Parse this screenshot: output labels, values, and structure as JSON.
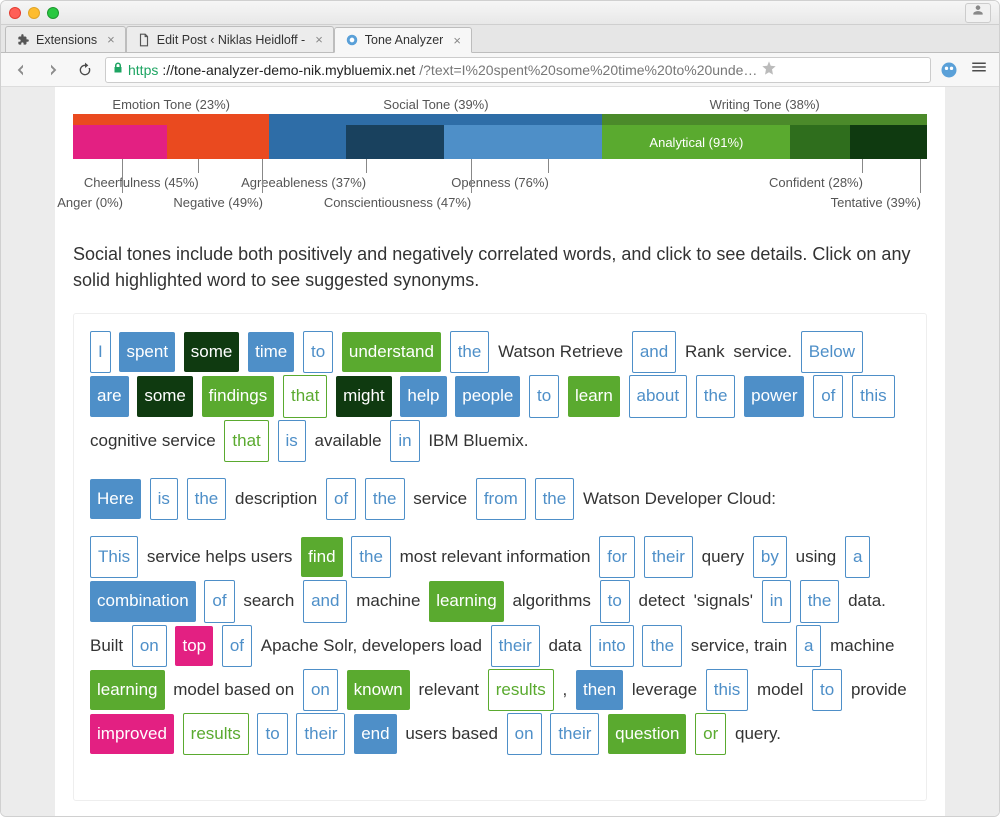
{
  "browser": {
    "tabs": [
      {
        "label": "Extensions",
        "active": false,
        "icon": "puzzle"
      },
      {
        "label": "Edit Post ‹ Niklas Heidloff - ",
        "active": false,
        "icon": "doc"
      },
      {
        "label": "Tone Analyzer",
        "active": true,
        "icon": "globe"
      }
    ],
    "url_https": "https",
    "url_host": "://tone-analyzer-demo-nik.mybluemix.net",
    "url_path": "/?text=I%20spent%20some%20time%20to%20unde…"
  },
  "categories": {
    "emotion": "Emotion Tone (23%)",
    "social": "Social Tone (39%)",
    "writing": "Writing Tone (38%)"
  },
  "chart_data": {
    "type": "bar",
    "groups": [
      {
        "name": "Emotion Tone",
        "pct": 23,
        "color": "#ea4a1f",
        "segments": [
          {
            "label": "Cheerfulness (45%)",
            "pct": 45,
            "color": "#e32082"
          },
          {
            "label": "Anger (0%)",
            "pct": 0,
            "color": "#e32082"
          },
          {
            "label": "Negative (49%)",
            "pct": 49,
            "color": "#ea4a1f"
          }
        ]
      },
      {
        "name": "Social Tone",
        "pct": 39,
        "color": "#2e6da7",
        "segments": [
          {
            "label": "Agreeableness (37%)",
            "pct": 37,
            "color": "#2e6da7"
          },
          {
            "label": "Conscientiousness (47%)",
            "pct": 47,
            "color": "#19415e"
          },
          {
            "label": "Openness (76%)",
            "pct": 76,
            "color": "#4e8fc8"
          }
        ]
      },
      {
        "name": "Writing Tone",
        "pct": 38,
        "color": "#4b8a2a",
        "segments": [
          {
            "label": "Analytical (91%)",
            "pct": 91,
            "color": "#5aaa2f"
          },
          {
            "label": "Confident (28%)",
            "pct": 28,
            "color": "#2f6e1d"
          },
          {
            "label": "Tentative (39%)",
            "pct": 39,
            "color": "#0f3a10"
          }
        ]
      }
    ],
    "highlight": "Analytical (91%)"
  },
  "ticks": {
    "cheer": "Cheerfulness (45%)",
    "anger": "Anger (0%)",
    "neg": "Negative (49%)",
    "agree": "Agreeableness (37%)",
    "consc": "Conscientiousness (47%)",
    "open": "Openness (76%)",
    "analytical": "Analytical (91%)",
    "conf": "Confident (28%)",
    "tent": "Tentative (39%)"
  },
  "instructions": "Social tones include both positively and negatively correlated words, and click to see details. Click on any solid highlighted word to see suggested synonyms.",
  "words": {
    "I": "I",
    "spent": "spent",
    "some": "some",
    "time": "time",
    "to": "to",
    "understand": "understand",
    "the": "the",
    "WatsonRetrieve": "Watson Retrieve",
    "and": "and",
    "Rank": "Rank",
    "service": "service.",
    "Below": "Below",
    "are": "are",
    "findings": "findings",
    "that": "that",
    "might": "might",
    "help": "help",
    "people": "people",
    "learn": "learn",
    "about": "about",
    "power": "power",
    "of": "of",
    "this": "this",
    "cognitiveservice": "cognitive service",
    "is": "is",
    "available": "available",
    "in": "in",
    "IBMBluemix": "IBM Bluemix.",
    "Here": "Here",
    "description": "description",
    "serviceword": "service",
    "from": "from",
    "WDC": "Watson Developer Cloud:",
    "This": "This",
    "servicehelps": "service helps users",
    "find": "find",
    "mostrelevant": "most relevant information",
    "for": "for",
    "their": "their",
    "query": "query",
    "by": "by",
    "using": "using",
    "a": "a",
    "combination": "combination",
    "search": "search",
    "machine": "machine",
    "learning": "learning",
    "algorithms": "algorithms",
    "detect": "detect",
    "signals": "'signals'",
    "data": "data.",
    "Built": "Built",
    "on": "on",
    "top": "top",
    "ApacheSolr": "Apache Solr, developers load",
    "dataword": "data",
    "into": "into",
    "servicetrain": "service, train",
    "machineword": "machine",
    "modelbased": "model based on",
    "known": "known",
    "relevant": "relevant",
    "results": "results",
    "then": "then",
    "leverage": "leverage",
    "model": "model",
    "provide": "provide",
    "improved": "improved",
    "resultsword": "results",
    "end": "end",
    "usersbased": "users based",
    "question": "question",
    "or": "or",
    "querydot": "query.",
    "comma": ",",
    "onword": "on"
  }
}
